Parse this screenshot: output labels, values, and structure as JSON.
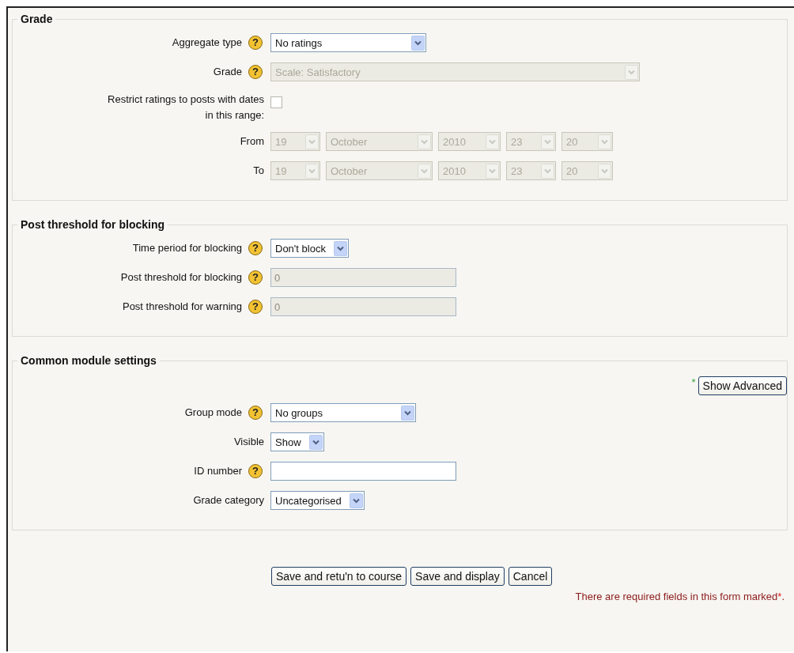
{
  "sections": [
    {
      "legend": "Grade",
      "fields": [
        {
          "label": "Aggregate type",
          "help": "?",
          "kind": "select",
          "value": "No ratings",
          "disabled": false
        },
        {
          "label": "Grade",
          "help": "?",
          "kind": "select",
          "value": "Scale: Satisfactory",
          "disabled": true
        },
        {
          "label": "Restrict ratings to posts with dates in this range:",
          "kind": "checkbox",
          "checked": false
        },
        {
          "label": "From",
          "kind": "date",
          "disabled": true,
          "parts": [
            "19",
            "October",
            "2010",
            "23",
            "20"
          ]
        },
        {
          "label": "To",
          "kind": "date",
          "disabled": true,
          "parts": [
            "19",
            "October",
            "2010",
            "23",
            "20"
          ]
        }
      ]
    },
    {
      "legend": "Post threshold for blocking",
      "fields": [
        {
          "label": "Time period for blocking",
          "help": "?",
          "kind": "select",
          "value": "Don't block",
          "disabled": false
        },
        {
          "label": "Post threshold for blocking",
          "help": "?",
          "kind": "text",
          "value": "0",
          "disabled": true
        },
        {
          "label": "Post threshold for warning",
          "help": "?",
          "kind": "text",
          "value": "0",
          "disabled": true
        }
      ]
    },
    {
      "legend": "Common module settings",
      "advanced": {
        "mark": "*",
        "label": "Show Advanced"
      },
      "fields": [
        {
          "label": "Group mode",
          "help": "?",
          "kind": "select",
          "value": "No groups",
          "disabled": false
        },
        {
          "label": "Visible",
          "kind": "select",
          "value": "Show",
          "disabled": false
        },
        {
          "label": "ID number",
          "help": "?",
          "kind": "text",
          "disabled": false
        },
        {
          "label": "Grade category",
          "kind": "select",
          "value": "Uncategorised",
          "disabled": false
        }
      ]
    }
  ],
  "buttons": [
    "Save and retu'n to course",
    "Save and display",
    "Cancel"
  ],
  "required_note": {
    "text": "There are required fields in this form marked",
    "mark": "*",
    "end": "."
  }
}
